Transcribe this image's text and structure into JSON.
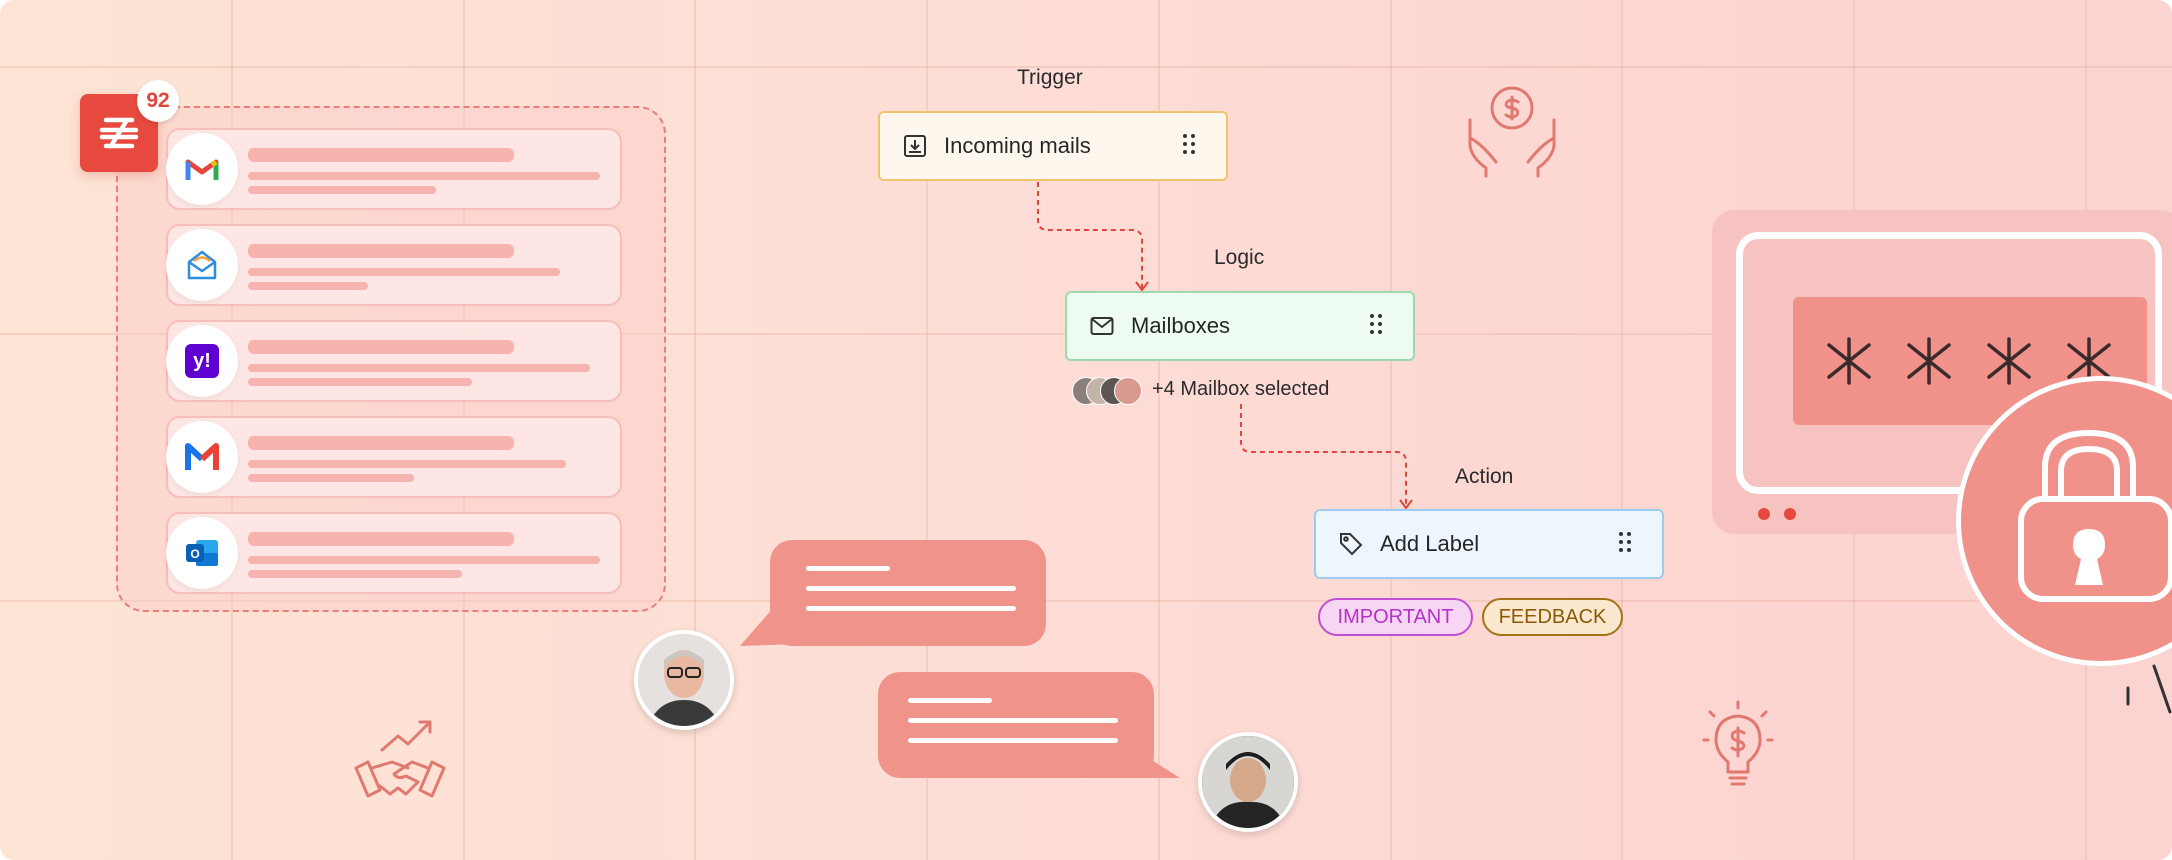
{
  "inbox": {
    "unread_count": "92",
    "app_icon": "zoho-mail-icon",
    "providers": [
      {
        "name": "gmail-icon"
      },
      {
        "name": "zoho-envelope-icon"
      },
      {
        "name": "yahoo-icon"
      },
      {
        "name": "mail-m-icon"
      },
      {
        "name": "outlook-icon"
      }
    ]
  },
  "flow": {
    "trigger": {
      "label": "Trigger",
      "node_text": "Incoming mails",
      "icon": "download-tray-icon"
    },
    "logic": {
      "label": "Logic",
      "node_text": "Mailboxes",
      "icon": "envelope-icon",
      "selection_text": "+4 Mailbox selected"
    },
    "action": {
      "label": "Action",
      "node_text": "Add Label",
      "icon": "tag-icon"
    },
    "tags": [
      {
        "text": "IMPORTANT",
        "color": "#b631c9",
        "bg": "#f7d6f4"
      },
      {
        "text": "FEEDBACK",
        "color": "#8a5a07",
        "bg": "#fbe8cf"
      }
    ]
  },
  "password": {
    "mask": "* * * *"
  },
  "colors": {
    "accent": "#e8493e",
    "coral": "#f0948b",
    "trigger_border": "#f2c36b",
    "logic_border": "#9ed9ad",
    "action_border": "#9ccbf0",
    "connector": "#e2453c"
  }
}
